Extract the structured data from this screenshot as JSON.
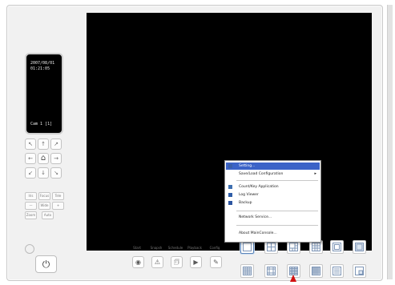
{
  "colors": {
    "video_bg": "#000000",
    "menu_highlight": "#3b63c7",
    "pointer": "#d21010"
  },
  "lcd": {
    "date": "2007/08/01",
    "time": "01:21:05",
    "camera": "Cam 1 [1]"
  },
  "ptz": {
    "up_left": "↖",
    "up": "↑",
    "up_right": "↗",
    "left": "←",
    "home": "⌂",
    "right": "→",
    "down_left": "↙",
    "down": "↓",
    "down_right": "↘",
    "fn": [
      "Iris",
      "Focus",
      "Tele",
      "—",
      "Wide",
      "+",
      "Zoom",
      "Auto"
    ]
  },
  "power_icon": "⏻",
  "controls": {
    "labels": [
      "Start",
      "Snapsh",
      "Schedule",
      "Playback",
      "Config"
    ],
    "icons": [
      "◉",
      "⚠",
      "🗊",
      "▶",
      "✎"
    ]
  },
  "menu": {
    "items": [
      {
        "label": "Setting...",
        "highlighted": true,
        "submenu": false,
        "icon": "settings-icon"
      },
      {
        "label": "Save/Load Configuration",
        "highlighted": false,
        "submenu": true,
        "icon": ""
      },
      {
        "label": "Count/Key Application",
        "highlighted": false,
        "submenu": false,
        "icon": "app-icon"
      },
      {
        "label": "Log Viewer",
        "highlighted": false,
        "submenu": false,
        "icon": "log-icon"
      },
      {
        "label": "Backup",
        "highlighted": false,
        "submenu": false,
        "icon": "backup-icon"
      },
      {
        "label": "Network Service...",
        "highlighted": false,
        "submenu": false,
        "icon": ""
      },
      {
        "label": "About MainConsole...",
        "highlighted": false,
        "submenu": false,
        "icon": ""
      }
    ],
    "submenu_arrow": "▸"
  }
}
